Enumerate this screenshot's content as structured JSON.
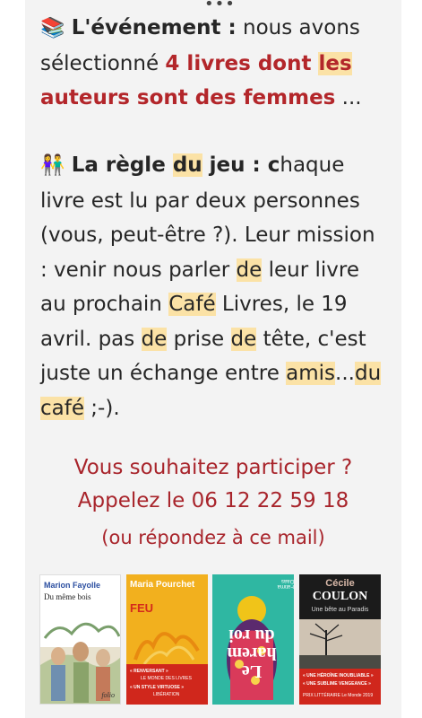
{
  "header_dots": "•••",
  "event": {
    "icon": "📚",
    "title": "L'événement :",
    "text1": " nous avons sélectionné ",
    "red1": "4 livres dont ",
    "red_hl": "les",
    "red2": " auteurs sont des femmes",
    "text2": " ..."
  },
  "rule": {
    "icon": "👫",
    "title_a": "La règle ",
    "title_hl": "du",
    "title_b": " jeu : c",
    "t1": "haque livre est lu par deux personnes (vous, peut-être ?). Leur mission : venir nous parler ",
    "h1": "de",
    "t2": " leur livre au prochain ",
    "h2": "Café",
    "t3": " Livres, le 19 avril. pas ",
    "h3": "de",
    "t4": " prise ",
    "h4": "de",
    "t5": " tête, c'est juste un échange entre ",
    "h5": "amis",
    "t6": "...",
    "h6": "du",
    "t7": " ",
    "h7": "café",
    "t8": " ;-)."
  },
  "cta": {
    "line1": "Vous souhaitez participer ?",
    "line2": "Appelez le 06 12 22 59 18",
    "line3": "(ou répondez à ce mail)"
  },
  "books": [
    {
      "author": "Marion Fayolle",
      "title": "Du même bois",
      "publisher": "folio"
    },
    {
      "author": "Maria Pourchet",
      "title": "FEU",
      "quote1": "« RENVERSANT »",
      "source1": "LE MONDE DES LIVRES",
      "quote2": "« UN STYLE VIRTUOSE »",
      "source2": "LIBÉRATION"
    },
    {
      "author": "Fatima Daas",
      "title": "Le harem du roi"
    },
    {
      "author": "Cécile",
      "author2": "COULON",
      "title": "Une bête au Paradis",
      "quote1": "« UNE HÉROÏNE INOUBLIABLE »",
      "quote2": "« UNE SUBLIME VENGEANCE »",
      "prize": "PRIX LITTÉRAIRE Le Monde 2019"
    }
  ],
  "colors": {
    "accent_red": "#b3262a",
    "highlight": "#fbe2a6",
    "card_bg": "#f3f3f3"
  }
}
